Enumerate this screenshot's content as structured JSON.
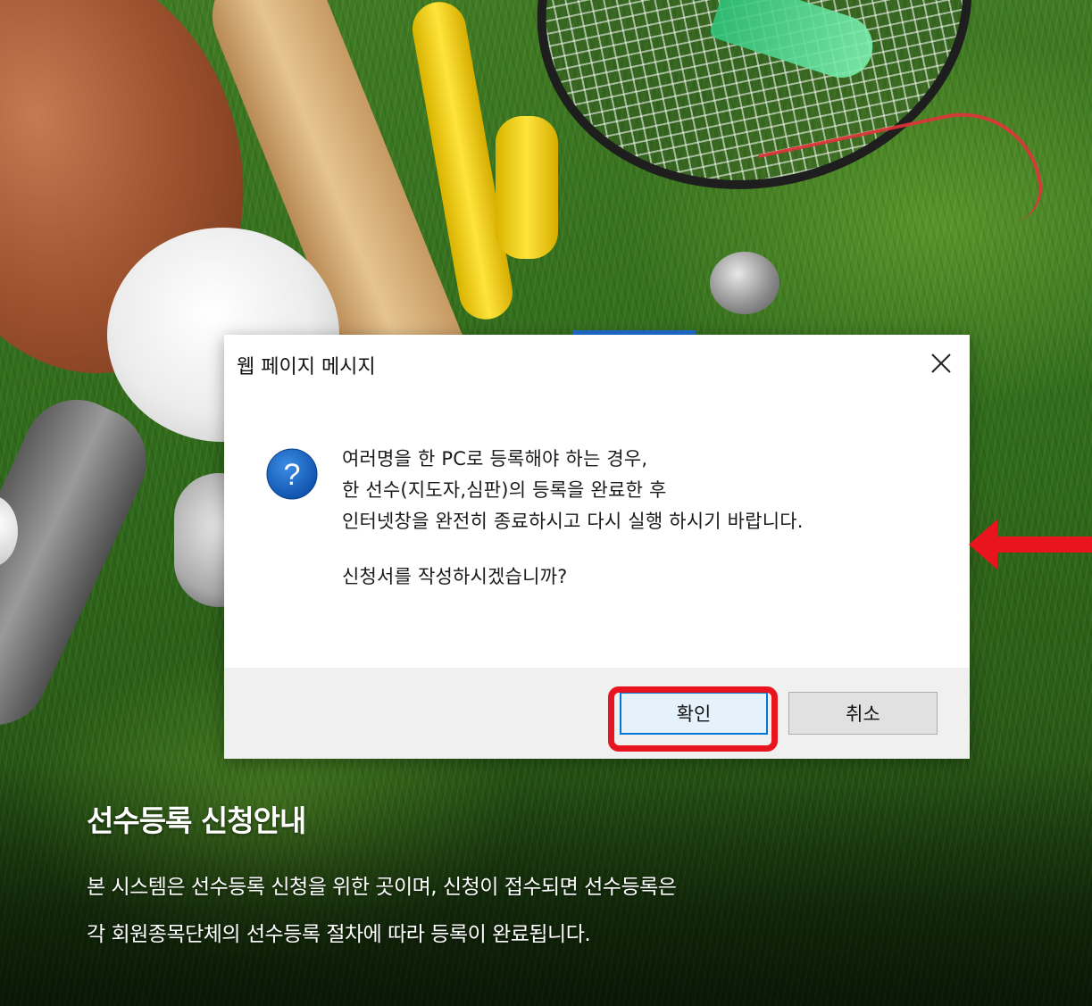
{
  "background": {
    "title": "선수등록 신청안내",
    "description_lines": [
      "본 시스템은 선수등록 신청을 위한 곳이며, 신청이 접수되면 선수등록은",
      "각 회원종목단체의 선수등록 절차에 따라 등록이 완료됩니다."
    ]
  },
  "dialog": {
    "title": "웹 페이지 메시지",
    "close_icon": "close-icon",
    "question_icon": "question-icon",
    "icon_glyph": "?",
    "message_lines": [
      "여러명을 한 PC로 등록해야 하는 경우,",
      "한 선수(지도자,심판)의 등록을 완료한 후",
      "인터넷창을 완전히 종료하시고 다시 실행 하시기 바랍니다."
    ],
    "question": "신청서를 작성하시겠습니까?",
    "ok_label": "확인",
    "cancel_label": "취소"
  },
  "annotations": {
    "highlight_color": "#e8141e",
    "arrow_color": "#e8141e"
  },
  "colors": {
    "accent": "#0078d7",
    "question_icon_bg": "#1565c0"
  }
}
